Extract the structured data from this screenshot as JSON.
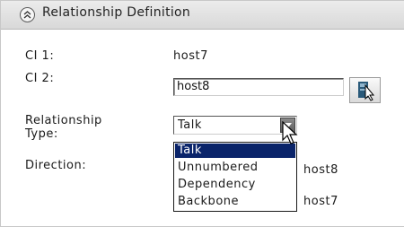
{
  "panel": {
    "title": "Relationship Definition"
  },
  "fields": {
    "ci1_label": "CI 1:",
    "ci1_value": "host7",
    "ci2_label": "CI 2:",
    "ci2_value": "host8",
    "rel_type_label_line1": "Relationship",
    "rel_type_label_line2": "Type:",
    "rel_type_selected": "Talk",
    "direction_label": "Direction:",
    "direction_value_1": "host8",
    "direction_value_2": "host7"
  },
  "dropdown": {
    "options": [
      "Talk",
      "Unnumbered",
      "Dependency",
      "Backbone"
    ],
    "highlighted": "Talk"
  },
  "icons": {
    "collapse": "collapse-chevron-up-icon",
    "picker": "select-ci-pointer-icon",
    "arrow": "chevron-down-icon"
  },
  "colors": {
    "selection": "#0a246a"
  }
}
